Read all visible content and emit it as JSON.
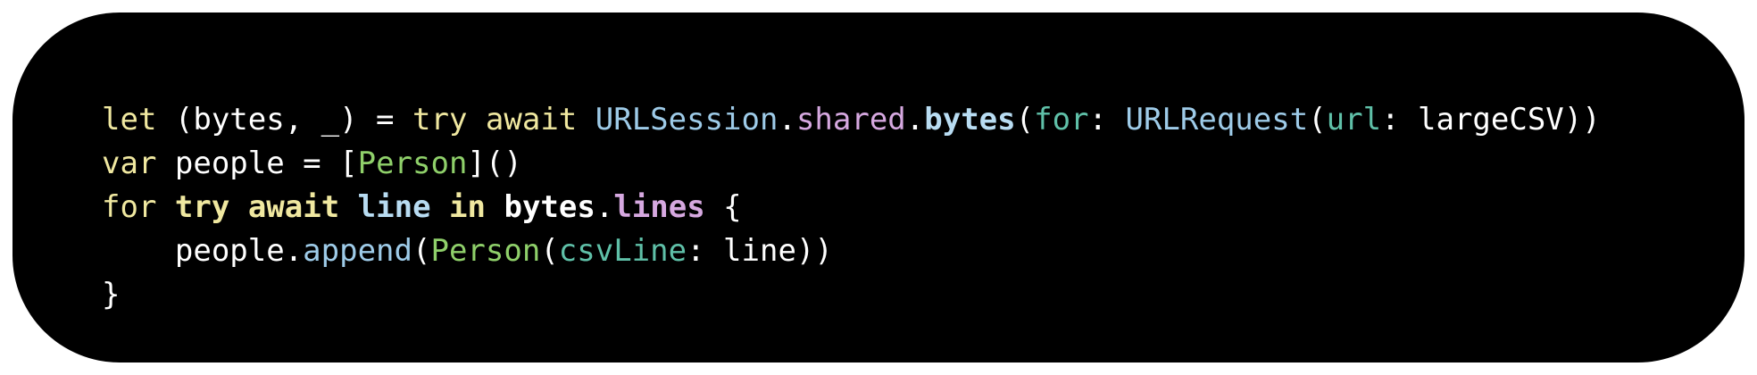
{
  "colors": {
    "background": "#000000",
    "page": "#ffffff",
    "plain": "#ffffff",
    "keyword": "#f0e8a0",
    "type": "#9ecbe8",
    "property": "#d6a8e0",
    "method": "#b8dcf2",
    "param": "#5fc0a8",
    "green_type": "#8fd06a"
  },
  "code_lines": [
    [
      {
        "text": "let",
        "kind": "keyword",
        "bold": false
      },
      {
        "text": " (bytes, _) = ",
        "kind": "plain",
        "bold": false
      },
      {
        "text": "try",
        "kind": "keyword",
        "bold": false
      },
      {
        "text": " ",
        "kind": "plain",
        "bold": false
      },
      {
        "text": "await",
        "kind": "keyword",
        "bold": false
      },
      {
        "text": " ",
        "kind": "plain",
        "bold": false
      },
      {
        "text": "URLSession",
        "kind": "type",
        "bold": false
      },
      {
        "text": ".",
        "kind": "plain",
        "bold": false
      },
      {
        "text": "shared",
        "kind": "property",
        "bold": false
      },
      {
        "text": ".",
        "kind": "plain",
        "bold": false
      },
      {
        "text": "bytes",
        "kind": "method",
        "bold": true
      },
      {
        "text": "(",
        "kind": "plain",
        "bold": false
      },
      {
        "text": "for",
        "kind": "param",
        "bold": false
      },
      {
        "text": ": ",
        "kind": "plain",
        "bold": false
      },
      {
        "text": "URLRequest",
        "kind": "type",
        "bold": false
      },
      {
        "text": "(",
        "kind": "plain",
        "bold": false
      },
      {
        "text": "url",
        "kind": "param",
        "bold": false
      },
      {
        "text": ": largeCSV))",
        "kind": "plain",
        "bold": false
      }
    ],
    [
      {
        "text": "var",
        "kind": "keyword",
        "bold": false
      },
      {
        "text": " people = [",
        "kind": "plain",
        "bold": false
      },
      {
        "text": "Person",
        "kind": "green_type",
        "bold": false
      },
      {
        "text": "]()",
        "kind": "plain",
        "bold": false
      }
    ],
    [
      {
        "text": "for",
        "kind": "keyword",
        "bold": false
      },
      {
        "text": " ",
        "kind": "plain",
        "bold": false
      },
      {
        "text": "try",
        "kind": "keyword",
        "bold": true
      },
      {
        "text": " ",
        "kind": "plain",
        "bold": false
      },
      {
        "text": "await",
        "kind": "keyword",
        "bold": true
      },
      {
        "text": " ",
        "kind": "plain",
        "bold": false
      },
      {
        "text": "line",
        "kind": "method",
        "bold": true
      },
      {
        "text": " ",
        "kind": "plain",
        "bold": false
      },
      {
        "text": "in",
        "kind": "keyword",
        "bold": true
      },
      {
        "text": " ",
        "kind": "plain",
        "bold": false
      },
      {
        "text": "bytes",
        "kind": "plain",
        "bold": true
      },
      {
        "text": ".",
        "kind": "plain",
        "bold": false
      },
      {
        "text": "lines",
        "kind": "property",
        "bold": true
      },
      {
        "text": " {",
        "kind": "plain",
        "bold": false
      }
    ],
    [
      {
        "text": "    people.",
        "kind": "plain",
        "bold": false
      },
      {
        "text": "append",
        "kind": "type",
        "bold": false
      },
      {
        "text": "(",
        "kind": "plain",
        "bold": false
      },
      {
        "text": "Person",
        "kind": "green_type",
        "bold": false
      },
      {
        "text": "(",
        "kind": "plain",
        "bold": false
      },
      {
        "text": "csvLine",
        "kind": "param",
        "bold": false
      },
      {
        "text": ": line))",
        "kind": "plain",
        "bold": false
      }
    ],
    [
      {
        "text": "}",
        "kind": "plain",
        "bold": false
      }
    ]
  ]
}
